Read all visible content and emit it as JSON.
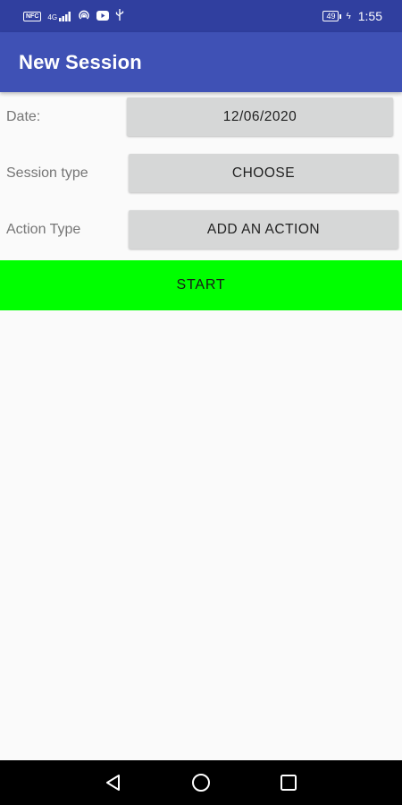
{
  "status_bar": {
    "nfc_label": "NFC",
    "signal_label": "4G",
    "battery": "49",
    "time": "1:55"
  },
  "app_bar": {
    "title": "New Session",
    "background": "#3f51b5",
    "status_color": "#303f9f"
  },
  "form": {
    "date_label": "Date:",
    "date_value": "12/06/2020",
    "session_type_label": "Session type",
    "session_type_button": "CHOOSE",
    "action_type_label": "Action Type",
    "action_type_button": "ADD AN ACTION"
  },
  "start_button": {
    "label": "START",
    "color": "#00ff00"
  },
  "nav_bar": {
    "icons": [
      "back-icon",
      "home-icon",
      "recents-icon"
    ]
  }
}
